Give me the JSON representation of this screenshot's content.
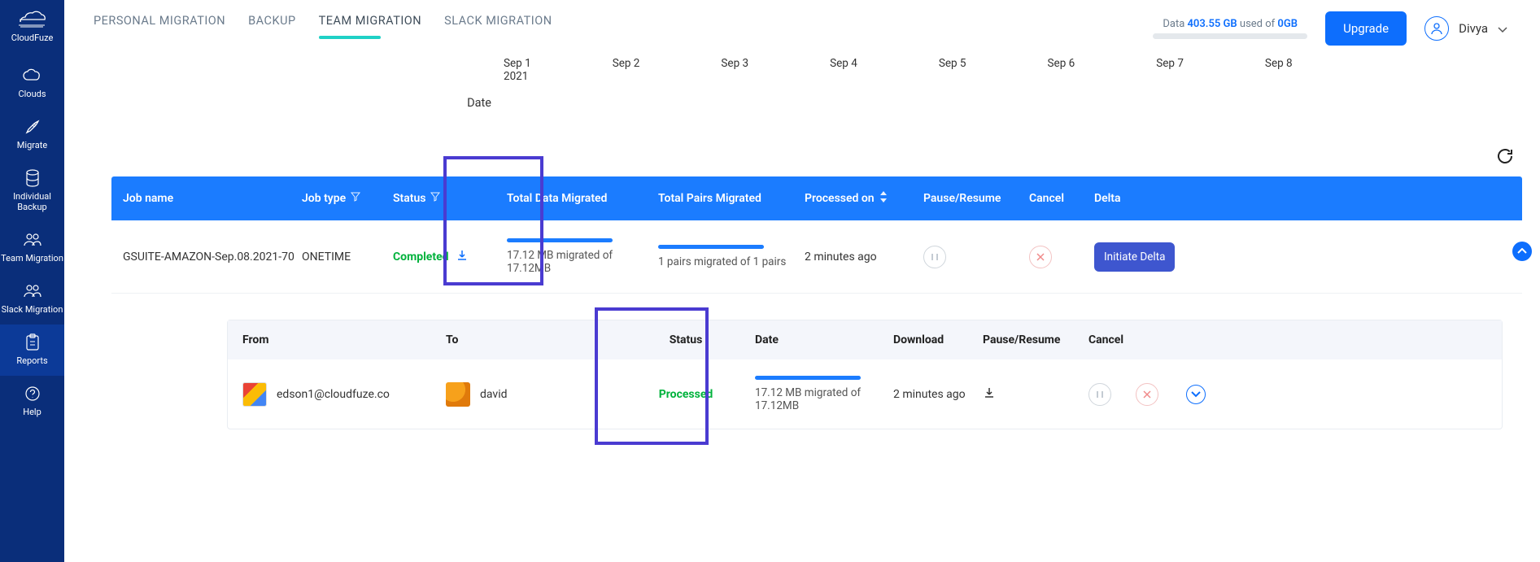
{
  "app": {
    "name": "CloudFuze"
  },
  "sidebar": {
    "items": [
      {
        "label": "Clouds"
      },
      {
        "label": "Migrate"
      },
      {
        "label": "Individual Backup"
      },
      {
        "label": "Team Migration"
      },
      {
        "label": "Slack Migration"
      },
      {
        "label": "Reports"
      },
      {
        "label": "Help"
      }
    ]
  },
  "tabs": [
    {
      "label": "PERSONAL MIGRATION"
    },
    {
      "label": "BACKUP"
    },
    {
      "label": "TEAM MIGRATION"
    },
    {
      "label": "SLACK MIGRATION"
    }
  ],
  "usage": {
    "prefix": "Data ",
    "used": "403.55 GB",
    "mid": " used of ",
    "limit": "0GB"
  },
  "upgrade": "Upgrade",
  "user": {
    "name": "Divya"
  },
  "timeline": {
    "dates": [
      "Sep 1",
      "Sep 2",
      "Sep 3",
      "Sep 4",
      "Sep 5",
      "Sep 6",
      "Sep 7",
      "Sep 8"
    ],
    "year": "2021",
    "axis_label": "Date"
  },
  "columns": {
    "job_name": "Job name",
    "job_type": "Job type",
    "status": "Status",
    "total_data": "Total Data Migrated",
    "total_pairs": "Total Pairs Migrated",
    "processed_on": "Processed on",
    "pause": "Pause/Resume",
    "cancel": "Cancel",
    "delta": "Delta"
  },
  "row": {
    "job_name": "GSUITE-AMAZON-Sep.08.2021-70",
    "job_type": "ONETIME",
    "status": "Completed",
    "data_migrated": "17.12 MB migrated of 17.12MB",
    "pairs_migrated": "1 pairs migrated of 1 pairs",
    "processed_on": "2 minutes ago",
    "delta_btn": "Initiate Delta"
  },
  "sub_columns": {
    "from": "From",
    "to": "To",
    "status": "Status",
    "date": "Date",
    "download": "Download",
    "pause": "Pause/Resume",
    "cancel": "Cancel"
  },
  "sub_row": {
    "from": "edson1@cloudfuze.co",
    "to": "david",
    "status": "Processed",
    "date_text": "17.12 MB migrated of 17.12MB",
    "download": "2 minutes ago"
  }
}
